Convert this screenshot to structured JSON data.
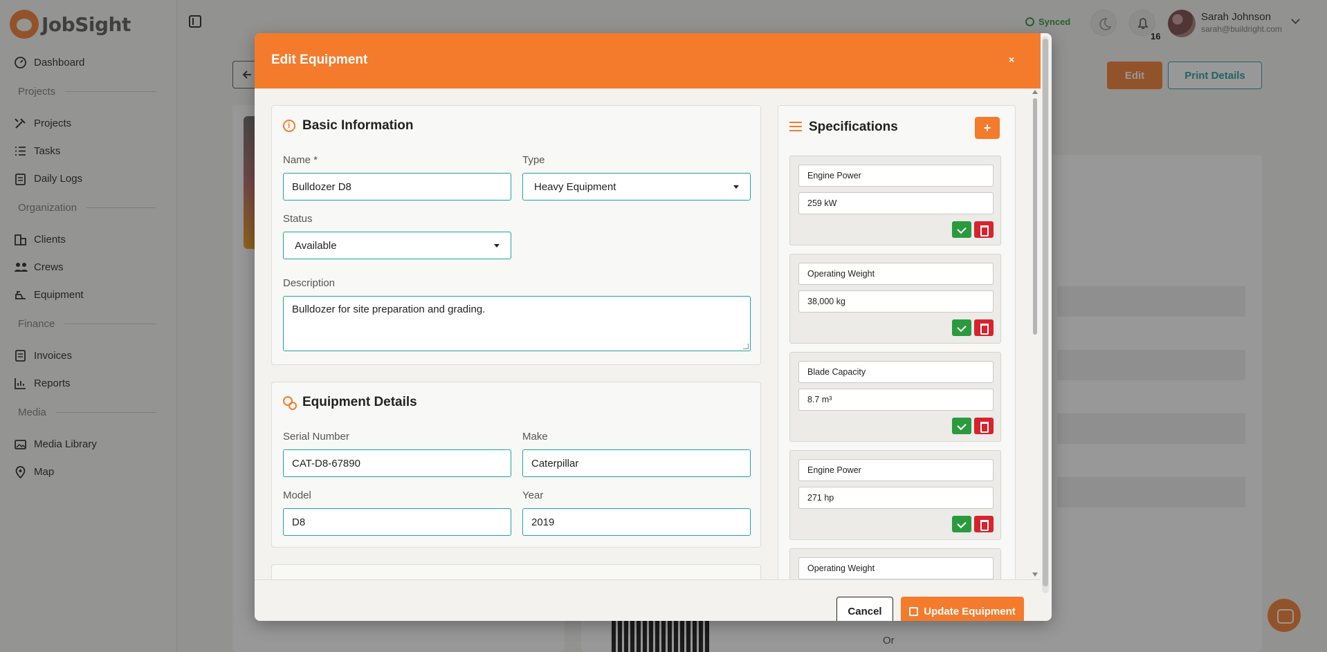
{
  "app": {
    "name": "JobSight",
    "brand_color": "#f47b2c"
  },
  "sidebar": {
    "sections": [
      {
        "label": "Projects"
      },
      {
        "label": "Organization"
      },
      {
        "label": "Finance"
      },
      {
        "label": "Media"
      }
    ],
    "items": [
      {
        "label": "Dashboard",
        "icon": "dashboard-icon"
      },
      {
        "label": "Projects",
        "icon": "projects-icon"
      },
      {
        "label": "Tasks",
        "icon": "tasks-icon"
      },
      {
        "label": "Daily Logs",
        "icon": "daily-logs-icon"
      },
      {
        "label": "Clients",
        "icon": "clients-icon"
      },
      {
        "label": "Crews",
        "icon": "crews-icon"
      },
      {
        "label": "Equipment",
        "icon": "equipment-icon"
      },
      {
        "label": "Invoices",
        "icon": "invoices-icon"
      },
      {
        "label": "Reports",
        "icon": "reports-icon"
      },
      {
        "label": "Media Library",
        "icon": "media-library-icon"
      },
      {
        "label": "Map",
        "icon": "map-pin-icon"
      }
    ]
  },
  "header": {
    "sync_status": "Synced",
    "notification_count": "16",
    "user": {
      "name": "Sarah Johnson",
      "email": "sarah@buildright.com"
    }
  },
  "page": {
    "edit_label": "Edit",
    "print_label": "Print Details",
    "or_label": "Or"
  },
  "modal": {
    "title": "Edit Equipment",
    "close_label": "×",
    "basic": {
      "title": "Basic Information",
      "name_label": "Name *",
      "name_value": "Bulldozer D8",
      "type_label": "Type",
      "type_value": "Heavy Equipment",
      "status_label": "Status",
      "status_value": "Available",
      "description_label": "Description",
      "description_value": "Bulldozer for site preparation and grading."
    },
    "details": {
      "title": "Equipment Details",
      "serial_label": "Serial Number",
      "serial_value": "CAT-D8-67890",
      "make_label": "Make",
      "make_value": "Caterpillar",
      "model_label": "Model",
      "model_value": "D8",
      "year_label": "Year",
      "year_value": "2019"
    },
    "specifications": {
      "title": "Specifications",
      "add_label": "+",
      "items": [
        {
          "name": "Engine Power",
          "value": "259 kW"
        },
        {
          "name": "Operating Weight",
          "value": "38,000 kg"
        },
        {
          "name": "Blade Capacity",
          "value": "8.7 m³"
        },
        {
          "name": "Engine Power",
          "value": "271 hp"
        },
        {
          "name": "Operating Weight",
          "value": ""
        }
      ]
    },
    "footer": {
      "cancel_label": "Cancel",
      "update_label": "Update Equipment"
    }
  }
}
